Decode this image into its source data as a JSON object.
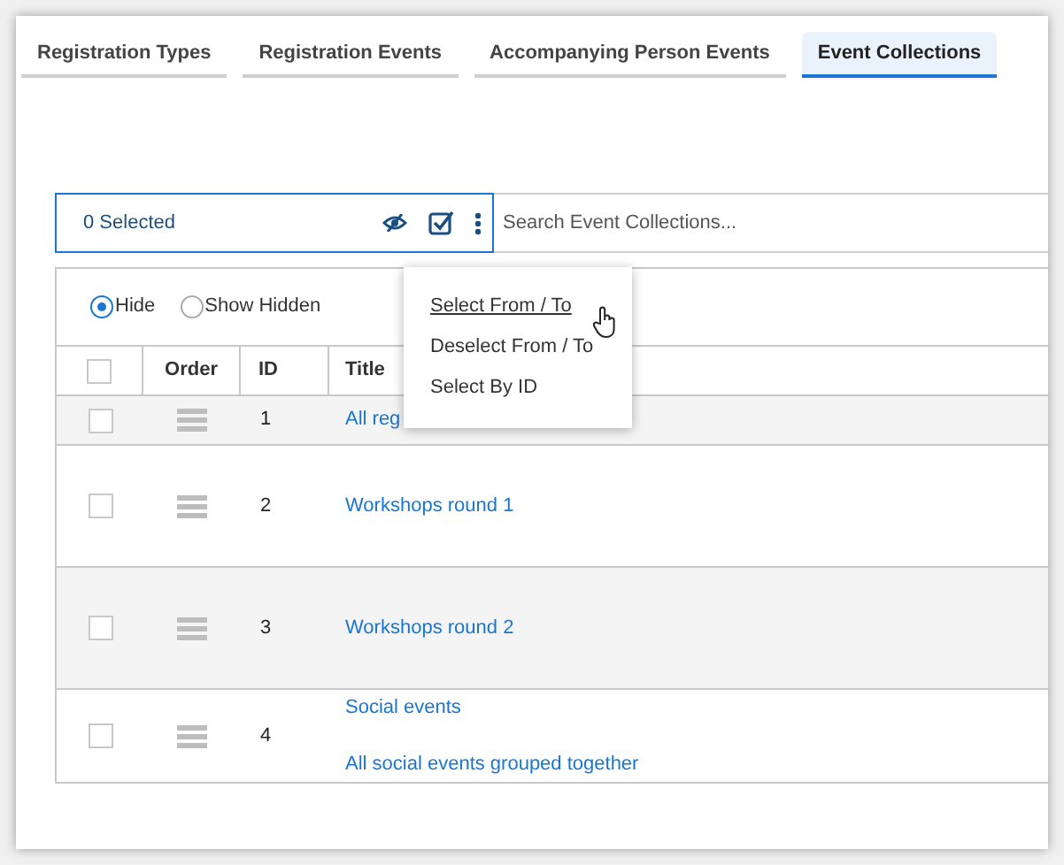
{
  "tabs": [
    {
      "label": "Registration Types",
      "selected": false
    },
    {
      "label": "Registration Events",
      "selected": false
    },
    {
      "label": "Accompanying Person Events",
      "selected": false
    },
    {
      "label": "Event Collections",
      "selected": true
    }
  ],
  "toolbar": {
    "selected_count": "0 Selected",
    "search": {
      "placeholder": "Search Event Collections..."
    }
  },
  "menu": {
    "items": [
      {
        "label": "Select From / To",
        "hovered": true
      },
      {
        "label": "Deselect From / To",
        "hovered": false
      },
      {
        "label": "Select By ID",
        "hovered": false
      }
    ]
  },
  "filter": [
    {
      "label": "Hide",
      "selected": true
    },
    {
      "label": "Show Hidden",
      "selected": false
    }
  ],
  "table": {
    "all_checked": false,
    "columns": [
      "Order",
      "ID",
      "Title"
    ],
    "rows": [
      {
        "id": "1",
        "title": "All reg",
        "checked": false
      },
      {
        "id": "2",
        "title": "Workshops round 1",
        "checked": false
      },
      {
        "id": "3",
        "title": "Workshops round 2",
        "checked": false
      },
      {
        "id": "4",
        "title": "Social events",
        "description": "All social events grouped together",
        "checked": false
      }
    ]
  }
}
